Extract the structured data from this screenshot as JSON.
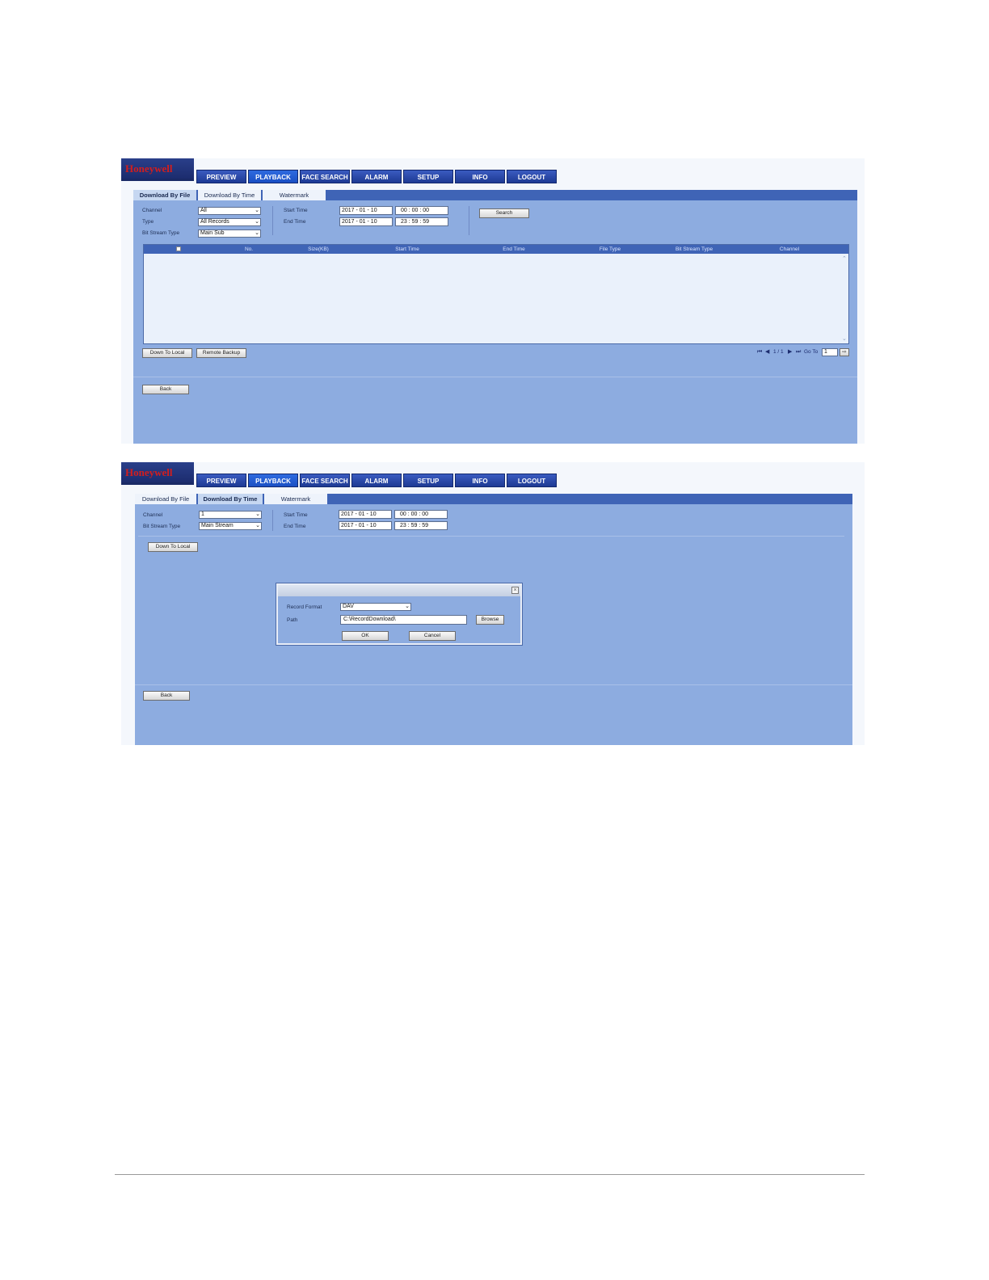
{
  "app": {
    "brand": "Honeywell",
    "nav": [
      "PREVIEW",
      "PLAYBACK",
      "FACE SEARCH",
      "ALARM",
      "SETUP",
      "INFO",
      "LOGOUT"
    ],
    "active_nav": "PLAYBACK",
    "accent_color": "#1e3a94",
    "panel_color": "#8dace0"
  },
  "shot1": {
    "tabs": [
      "Download By File",
      "Download By Time",
      "Watermark"
    ],
    "active_tab": "Download By File",
    "fields": {
      "channel_label": "Channel",
      "channel_value": "All",
      "type_label": "Type",
      "type_value": "All Records",
      "bitstream_label": "Bit Stream Type",
      "bitstream_value": "Main Sub",
      "start_label": "Start Time",
      "start_date": "2017 - 01 - 10",
      "start_time": "00 : 00 : 00",
      "end_label": "End Time",
      "end_date": "2017 - 01 - 10",
      "end_time": "23 : 59 : 59"
    },
    "search_button": "Search",
    "table_columns": [
      "No.",
      "Size(KB)",
      "Start Time",
      "End Time",
      "File Type",
      "Bit Stream Type",
      "Channel"
    ],
    "buttons": {
      "down_to_local": "Down To Local",
      "remote_backup": "Remote Backup",
      "back": "Back"
    },
    "pager": {
      "page_info": "1 / 1",
      "goto_label": "Go To",
      "goto_value": "1"
    }
  },
  "shot2": {
    "tabs": [
      "Download By File",
      "Download By Time",
      "Watermark"
    ],
    "active_tab": "Download By Time",
    "fields": {
      "channel_label": "Channel",
      "channel_value": "1",
      "bitstream_label": "Bit Stream Type",
      "bitstream_value": "Main Stream",
      "start_label": "Start Time",
      "start_date": "2017 - 01 - 10",
      "start_time": "00 : 00 : 00",
      "end_label": "End Time",
      "end_date": "2017 - 01 - 10",
      "end_time": "23 : 59 : 59"
    },
    "buttons": {
      "down_to_local": "Down To Local",
      "back": "Back"
    },
    "dialog": {
      "format_label": "Record Format",
      "format_value": "DAV",
      "path_label": "Path",
      "path_value": "C:\\RecordDownload\\",
      "browse": "Browse",
      "ok": "OK",
      "cancel": "Cancel"
    }
  }
}
